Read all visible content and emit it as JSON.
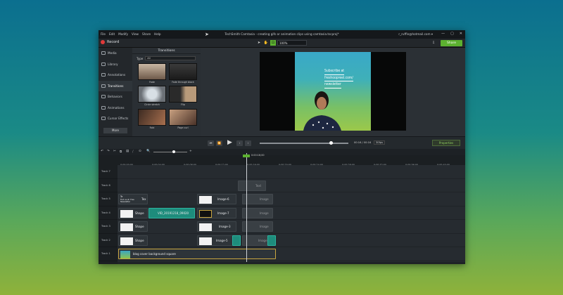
{
  "window": {
    "title": "TechSmith Camtasia - creating gifs or animation clips using camtasia.tscproj*",
    "menu": [
      "File",
      "Edit",
      "Modify",
      "View",
      "Share",
      "Help"
    ],
    "account": "r_ruffin@hotmail.com ▾",
    "controls": [
      "—",
      "▢",
      "✕"
    ]
  },
  "toolbar": {
    "record_label": "Record",
    "zoom_value": "100%",
    "share_label": "Share"
  },
  "sidebar": {
    "items": [
      {
        "label": "Media",
        "icon": "media-icon"
      },
      {
        "label": "Library",
        "icon": "library-icon"
      },
      {
        "label": "Annotations",
        "icon": "annotations-icon"
      },
      {
        "label": "Transitions",
        "icon": "transitions-icon"
      },
      {
        "label": "Behaviors",
        "icon": "behaviors-icon"
      },
      {
        "label": "Animations",
        "icon": "animations-icon"
      },
      {
        "label": "Cursor Effects",
        "icon": "cursor-effects-icon"
      }
    ],
    "more_label": "More"
  },
  "transitions": {
    "title": "Transitions",
    "type_label": "Type",
    "type_value": "All",
    "items": [
      "Fade",
      "Fade through black",
      "Circle stretch",
      "Flip",
      "Fold",
      "Page curl"
    ]
  },
  "canvas": {
    "subscribe_lines": [
      "Subscribe at",
      "freshoopreel.com/",
      "newsletter"
    ]
  },
  "player": {
    "time": "00:16 / 00:16",
    "fps": "30fps",
    "properties_label": "Properties"
  },
  "timeline": {
    "playhead_time": "0:00:16;00",
    "ruler": [
      "0:00:00;00",
      "0:00:04;00",
      "0:00:08;00",
      "0:00:12;00",
      "0:00:16;00",
      "0:00:20;00",
      "0:00:24;00",
      "0:00:28;00",
      "0:00:32;00",
      "0:00:36;00",
      "0:00:40;00"
    ],
    "tracks": [
      "Track 7",
      "Track 6",
      "Track 5",
      "Track 4",
      "Track 3",
      "Track 2",
      "Track 1"
    ],
    "clips": {
      "t6_ghost": "Text",
      "t5_text_a": "Te",
      "t5_text_b": "Find us at: Free Newsletter",
      "t5_text_c": "Tex",
      "t5_image": "Image-6",
      "t5_ghost": "Image",
      "t4_shape": "Shape",
      "t4_video": "VID_20191218_09020",
      "t4_image": "Image-7",
      "t4_ghost": "Image",
      "t3_shape": "Shape",
      "t3_image": "Image-3",
      "t3_ghost": "Image",
      "t2_shape": "Shape",
      "t2_image": "Image-5",
      "t2_ghost": "Image",
      "t1_bg": "blog cover background square"
    }
  },
  "colors": {
    "accent": "#5cb130",
    "teal_clip": "#1e8c7c",
    "record": "#e03a3a"
  }
}
